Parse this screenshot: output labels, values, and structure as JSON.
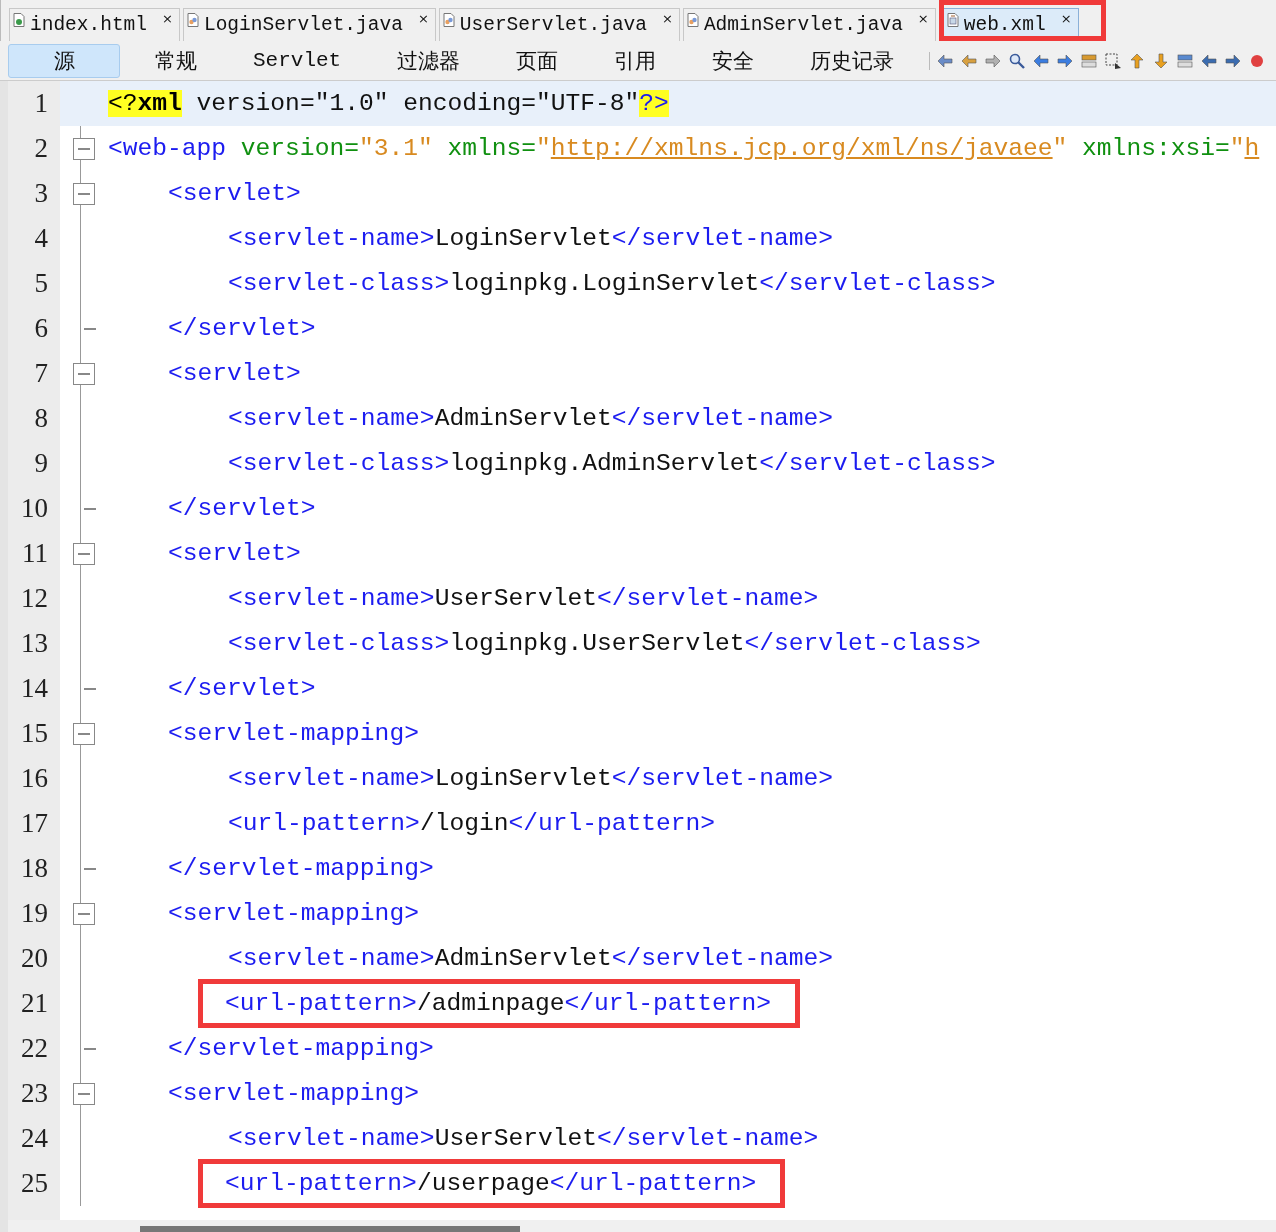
{
  "tabs": [
    {
      "label": "index.html",
      "kind": "html",
      "selected": false,
      "annotated": false
    },
    {
      "label": "LoginServlet.java",
      "kind": "java",
      "selected": false,
      "annotated": false
    },
    {
      "label": "UserServlet.java",
      "kind": "java",
      "selected": false,
      "annotated": false
    },
    {
      "label": "AdminServlet.java",
      "kind": "java",
      "selected": false,
      "annotated": false
    },
    {
      "label": "web.xml",
      "kind": "xml",
      "selected": true,
      "annotated": true
    }
  ],
  "close_glyph": "×",
  "views": [
    {
      "label": "源",
      "selected": true
    },
    {
      "label": "常规",
      "selected": false
    },
    {
      "label": "Servlet",
      "selected": false
    },
    {
      "label": "过滤器",
      "selected": false
    },
    {
      "label": "页面",
      "selected": false
    },
    {
      "label": "引用",
      "selected": false
    },
    {
      "label": "安全",
      "selected": false
    },
    {
      "label": "历史记录",
      "selected": false
    }
  ],
  "code": [
    {
      "n": "1",
      "tokens": [
        {
          "kind": "pi",
          "t": "<?"
        },
        {
          "kind": "pi-name",
          "t": "xml"
        },
        {
          "kind": "text",
          "t": " version=\"1.0\" encoding=\"UTF-8\""
        },
        {
          "kind": "pi-end",
          "t": "?>"
        }
      ]
    },
    {
      "n": "2",
      "expanded": true,
      "tokens": [
        {
          "kind": "tag",
          "t": "<web-app"
        },
        {
          "kind": "attr",
          "t": " version="
        },
        {
          "kind": "value",
          "t": "\"3.1\""
        },
        {
          "kind": "attr",
          "t": " xmlns="
        },
        {
          "kind": "value",
          "t": "\""
        },
        {
          "kind": "link",
          "t": "http://xmlns.jcp.org/xml/ns/javaee"
        },
        {
          "kind": "value",
          "t": "\""
        },
        {
          "kind": "attr",
          "t": " xmlns:xsi="
        },
        {
          "kind": "value",
          "t": "\""
        },
        {
          "kind": "link",
          "t": "h"
        }
      ],
      "children": [
        {
          "n": "3",
          "expanded": true,
          "tokens": [
            {
              "kind": "tag",
              "t": "<servlet>"
            }
          ],
          "children": [
            {
              "n": "4",
              "tokens": [
                {
                  "kind": "tag",
                  "t": "<servlet-name>"
                },
                {
                  "kind": "text",
                  "t": "LoginServlet"
                },
                {
                  "kind": "tag",
                  "t": "</servlet-name>"
                }
              ]
            },
            {
              "n": "5",
              "tokens": [
                {
                  "kind": "tag",
                  "t": "<servlet-class>"
                },
                {
                  "kind": "text",
                  "t": "loginpkg.LoginServlet"
                },
                {
                  "kind": "tag",
                  "t": "</servlet-class>"
                }
              ]
            }
          ],
          "close": {
            "n": "6",
            "tokens": [
              {
                "kind": "tag",
                "t": "</servlet>"
              }
            ]
          }
        },
        {
          "n": "7",
          "expanded": true,
          "tokens": [
            {
              "kind": "tag",
              "t": "<servlet>"
            }
          ],
          "children": [
            {
              "n": "8",
              "tokens": [
                {
                  "kind": "tag",
                  "t": "<servlet-name>"
                },
                {
                  "kind": "text",
                  "t": "AdminServlet"
                },
                {
                  "kind": "tag",
                  "t": "</servlet-name>"
                }
              ]
            },
            {
              "n": "9",
              "tokens": [
                {
                  "kind": "tag",
                  "t": "<servlet-class>"
                },
                {
                  "kind": "text",
                  "t": "loginpkg.AdminServlet"
                },
                {
                  "kind": "tag",
                  "t": "</servlet-class>"
                }
              ]
            }
          ],
          "close": {
            "n": "10",
            "tokens": [
              {
                "kind": "tag",
                "t": "</servlet>"
              }
            ]
          }
        },
        {
          "n": "11",
          "expanded": true,
          "tokens": [
            {
              "kind": "tag",
              "t": "<servlet>"
            }
          ],
          "children": [
            {
              "n": "12",
              "tokens": [
                {
                  "kind": "tag",
                  "t": "<servlet-name>"
                },
                {
                  "kind": "text",
                  "t": "UserServlet"
                },
                {
                  "kind": "tag",
                  "t": "</servlet-name>"
                }
              ]
            },
            {
              "n": "13",
              "tokens": [
                {
                  "kind": "tag",
                  "t": "<servlet-class>"
                },
                {
                  "kind": "text",
                  "t": "loginpkg.UserServlet"
                },
                {
                  "kind": "tag",
                  "t": "</servlet-class>"
                }
              ]
            }
          ],
          "close": {
            "n": "14",
            "tokens": [
              {
                "kind": "tag",
                "t": "</servlet>"
              }
            ]
          }
        },
        {
          "n": "15",
          "expanded": true,
          "tokens": [
            {
              "kind": "tag",
              "t": "<servlet-mapping>"
            }
          ],
          "children": [
            {
              "n": "16",
              "tokens": [
                {
                  "kind": "tag",
                  "t": "<servlet-name>"
                },
                {
                  "kind": "text",
                  "t": "LoginServlet"
                },
                {
                  "kind": "tag",
                  "t": "</servlet-name>"
                }
              ]
            },
            {
              "n": "17",
              "tokens": [
                {
                  "kind": "tag",
                  "t": "<url-pattern>"
                },
                {
                  "kind": "text",
                  "t": "/login"
                },
                {
                  "kind": "tag",
                  "t": "</url-pattern>"
                }
              ]
            }
          ],
          "close": {
            "n": "18",
            "tokens": [
              {
                "kind": "tag",
                "t": "</servlet-mapping>"
              }
            ]
          }
        },
        {
          "n": "19",
          "expanded": true,
          "tokens": [
            {
              "kind": "tag",
              "t": "<servlet-mapping>"
            }
          ],
          "children": [
            {
              "n": "20",
              "tokens": [
                {
                  "kind": "tag",
                  "t": "<servlet-name>"
                },
                {
                  "kind": "text",
                  "t": "AdminServlet"
                },
                {
                  "kind": "tag",
                  "t": "</servlet-name>"
                }
              ]
            },
            {
              "n": "21",
              "annotated": true,
              "tokens": [
                {
                  "kind": "tag",
                  "t": "<url-pattern>"
                },
                {
                  "kind": "text",
                  "t": "/adminpage"
                },
                {
                  "kind": "tag",
                  "t": "</url-pattern>"
                }
              ]
            }
          ],
          "close": {
            "n": "22",
            "tokens": [
              {
                "kind": "tag",
                "t": "</servlet-mapping>"
              }
            ]
          }
        },
        {
          "n": "23",
          "expanded": true,
          "tokens": [
            {
              "kind": "tag",
              "t": "<servlet-mapping>"
            }
          ],
          "children": [
            {
              "n": "24",
              "tokens": [
                {
                  "kind": "tag",
                  "t": "<servlet-name>"
                },
                {
                  "kind": "text",
                  "t": "UserServlet"
                },
                {
                  "kind": "tag",
                  "t": "</servlet-name>"
                }
              ]
            },
            {
              "n": "25",
              "annotated": true,
              "tokens": [
                {
                  "kind": "tag",
                  "t": "<url-pattern>"
                },
                {
                  "kind": "text",
                  "t": "/userpage"
                },
                {
                  "kind": "tag",
                  "t": "</url-pattern>"
                }
              ]
            }
          ]
        }
      ]
    }
  ]
}
